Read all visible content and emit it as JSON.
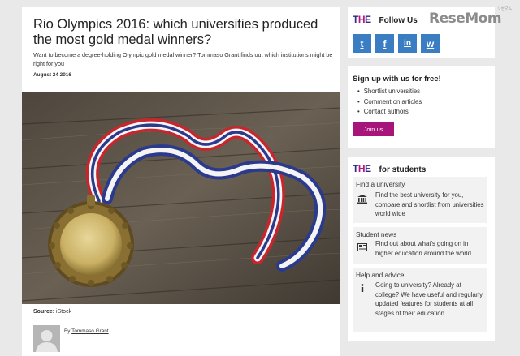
{
  "article": {
    "title": "Rio Olympics 2016: which universities produced the most gold medal winners?",
    "lede": "Want to become a degree-holding Olympic gold medal winner? Tommaso Grant finds out which institutions might be right for you",
    "date": "August 24 2016",
    "source_label": "Source:",
    "source_value": "iStock",
    "author_prefix": "By",
    "author_name": "Tommaso Grant"
  },
  "follow": {
    "logo_t": "T",
    "logo_h": "H",
    "logo_e": "E",
    "title": "Follow Us",
    "socials": [
      {
        "icon": "twitter-icon",
        "glyph": "t"
      },
      {
        "icon": "facebook-icon",
        "glyph": "f"
      },
      {
        "icon": "linkedin-icon",
        "glyph": "in"
      },
      {
        "icon": "weibo-icon",
        "glyph": "w"
      }
    ]
  },
  "signup": {
    "title": "Sign up with us for free!",
    "items": [
      "Shortlist universities",
      "Comment on articles",
      "Contact authors"
    ],
    "button": "Join us"
  },
  "students": {
    "title": "for students",
    "cards": [
      {
        "title": "Find a university",
        "icon": "university-building-icon",
        "text": "Find the best university for you, compare and shortlist from universities world wide"
      },
      {
        "title": "Student news",
        "icon": "newspaper-icon",
        "text": "Find out about what's going on in higher education around the world"
      },
      {
        "title": "Help and advice",
        "icon": "info-icon",
        "text": "Going to university? Already at college? We have useful and regularly updated features for students at all stages of their education"
      }
    ]
  },
  "watermark": {
    "brand": "ReseMom",
    "sub": "リセマム"
  },
  "colors": {
    "accent": "#a8157a",
    "social": "#3b7dc2",
    "logo_blue": "#2d2a8c"
  }
}
